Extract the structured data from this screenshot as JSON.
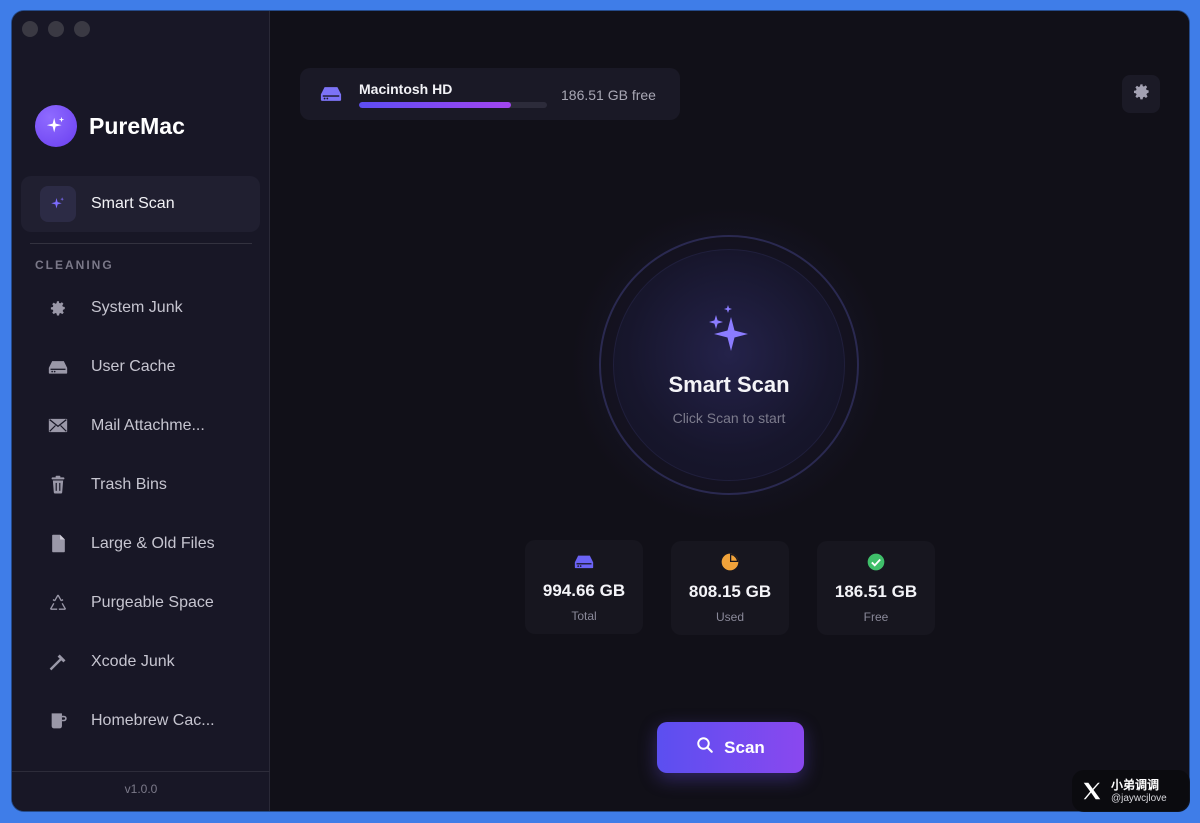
{
  "app": {
    "name": "PureMac",
    "version": "v1.0.0"
  },
  "sidebar": {
    "smart_scan_label": "Smart Scan",
    "section_title": "CLEANING",
    "items": [
      {
        "label": "System Junk",
        "icon": "gear-icon"
      },
      {
        "label": "User Cache",
        "icon": "drive-icon"
      },
      {
        "label": "Mail Attachme...",
        "icon": "mail-icon"
      },
      {
        "label": "Trash Bins",
        "icon": "trash-icon"
      },
      {
        "label": "Large & Old Files",
        "icon": "document-icon"
      },
      {
        "label": "Purgeable Space",
        "icon": "recycle-icon"
      },
      {
        "label": "Xcode Junk",
        "icon": "hammer-icon"
      },
      {
        "label": "Homebrew Cac...",
        "icon": "mug-icon"
      }
    ]
  },
  "disk": {
    "name": "Macintosh HD",
    "free_label": "186.51 GB free",
    "used_fraction": 0.81
  },
  "scan": {
    "title": "Smart Scan",
    "subtitle": "Click Scan to start",
    "button_label": "Scan"
  },
  "stats": [
    {
      "value": "994.66 GB",
      "label": "Total",
      "icon": "drive-icon",
      "color": "#6b63f5"
    },
    {
      "value": "808.15 GB",
      "label": "Used",
      "icon": "pie-chart-icon",
      "color": "#f0a23a"
    },
    {
      "value": "186.51 GB",
      "label": "Free",
      "icon": "check-circle-icon",
      "color": "#3fbf6a"
    }
  ],
  "colors": {
    "accent": "#6a4cf2",
    "accent_end": "#8a48ef",
    "background": "#111018",
    "sidebar": "#181726"
  },
  "watermark": {
    "name": "小弟调调",
    "handle": "@jaywcjlove"
  }
}
